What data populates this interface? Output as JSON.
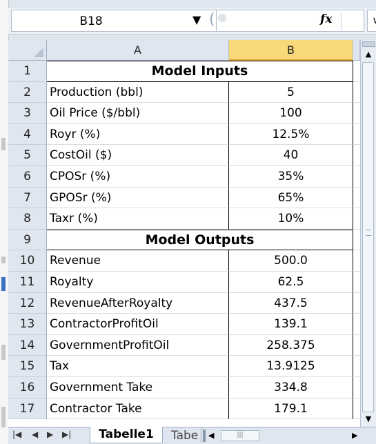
{
  "formula_bar": {
    "name_box": "B18",
    "fx_label": "fx",
    "formula": ""
  },
  "columns": [
    "A",
    "B"
  ],
  "selected_cell": "B18",
  "rows": [
    {
      "num": "1",
      "merged": "Model Inputs"
    },
    {
      "num": "2",
      "a": "Production (bbl)",
      "b": "5"
    },
    {
      "num": "3",
      "a": "Oil Price ($/bbl)",
      "b": "100"
    },
    {
      "num": "4",
      "a": "Royr (%)",
      "b": "12.5%"
    },
    {
      "num": "5",
      "a": "CostOil ($)",
      "b": "40"
    },
    {
      "num": "6",
      "a": "CPOSr (%)",
      "b": "35%"
    },
    {
      "num": "7",
      "a": "GPOSr (%)",
      "b": "65%"
    },
    {
      "num": "8",
      "a": "Taxr (%)",
      "b": "10%"
    },
    {
      "num": "9",
      "merged": "Model Outputs"
    },
    {
      "num": "10",
      "a": "Revenue",
      "b": "500.0"
    },
    {
      "num": "11",
      "a": "Royalty",
      "b": "62.5"
    },
    {
      "num": "12",
      "a": "RevenueAfterRoyalty",
      "b": "437.5"
    },
    {
      "num": "13",
      "a": "ContractorProfitOil",
      "b": "139.1"
    },
    {
      "num": "14",
      "a": "GovernmentProfitOil",
      "b": "258.375"
    },
    {
      "num": "15",
      "a": "Tax",
      "b": "13.9125"
    },
    {
      "num": "16",
      "a": "Government Take",
      "b": "334.8"
    },
    {
      "num": "17",
      "a": "Contractor Take",
      "b": "179.1"
    }
  ],
  "sheet_tabs": {
    "active": "Tabelle1",
    "inactive": "Tabe"
  },
  "icons": {
    "nav": [
      "first-sheet-icon",
      "prev-sheet-icon",
      "next-sheet-icon",
      "last-sheet-icon"
    ],
    "name_box_dropdown": "chevron-down-icon"
  },
  "colors": {
    "selected_header": "#f8d878",
    "header_bg": "#dfe6ef"
  }
}
